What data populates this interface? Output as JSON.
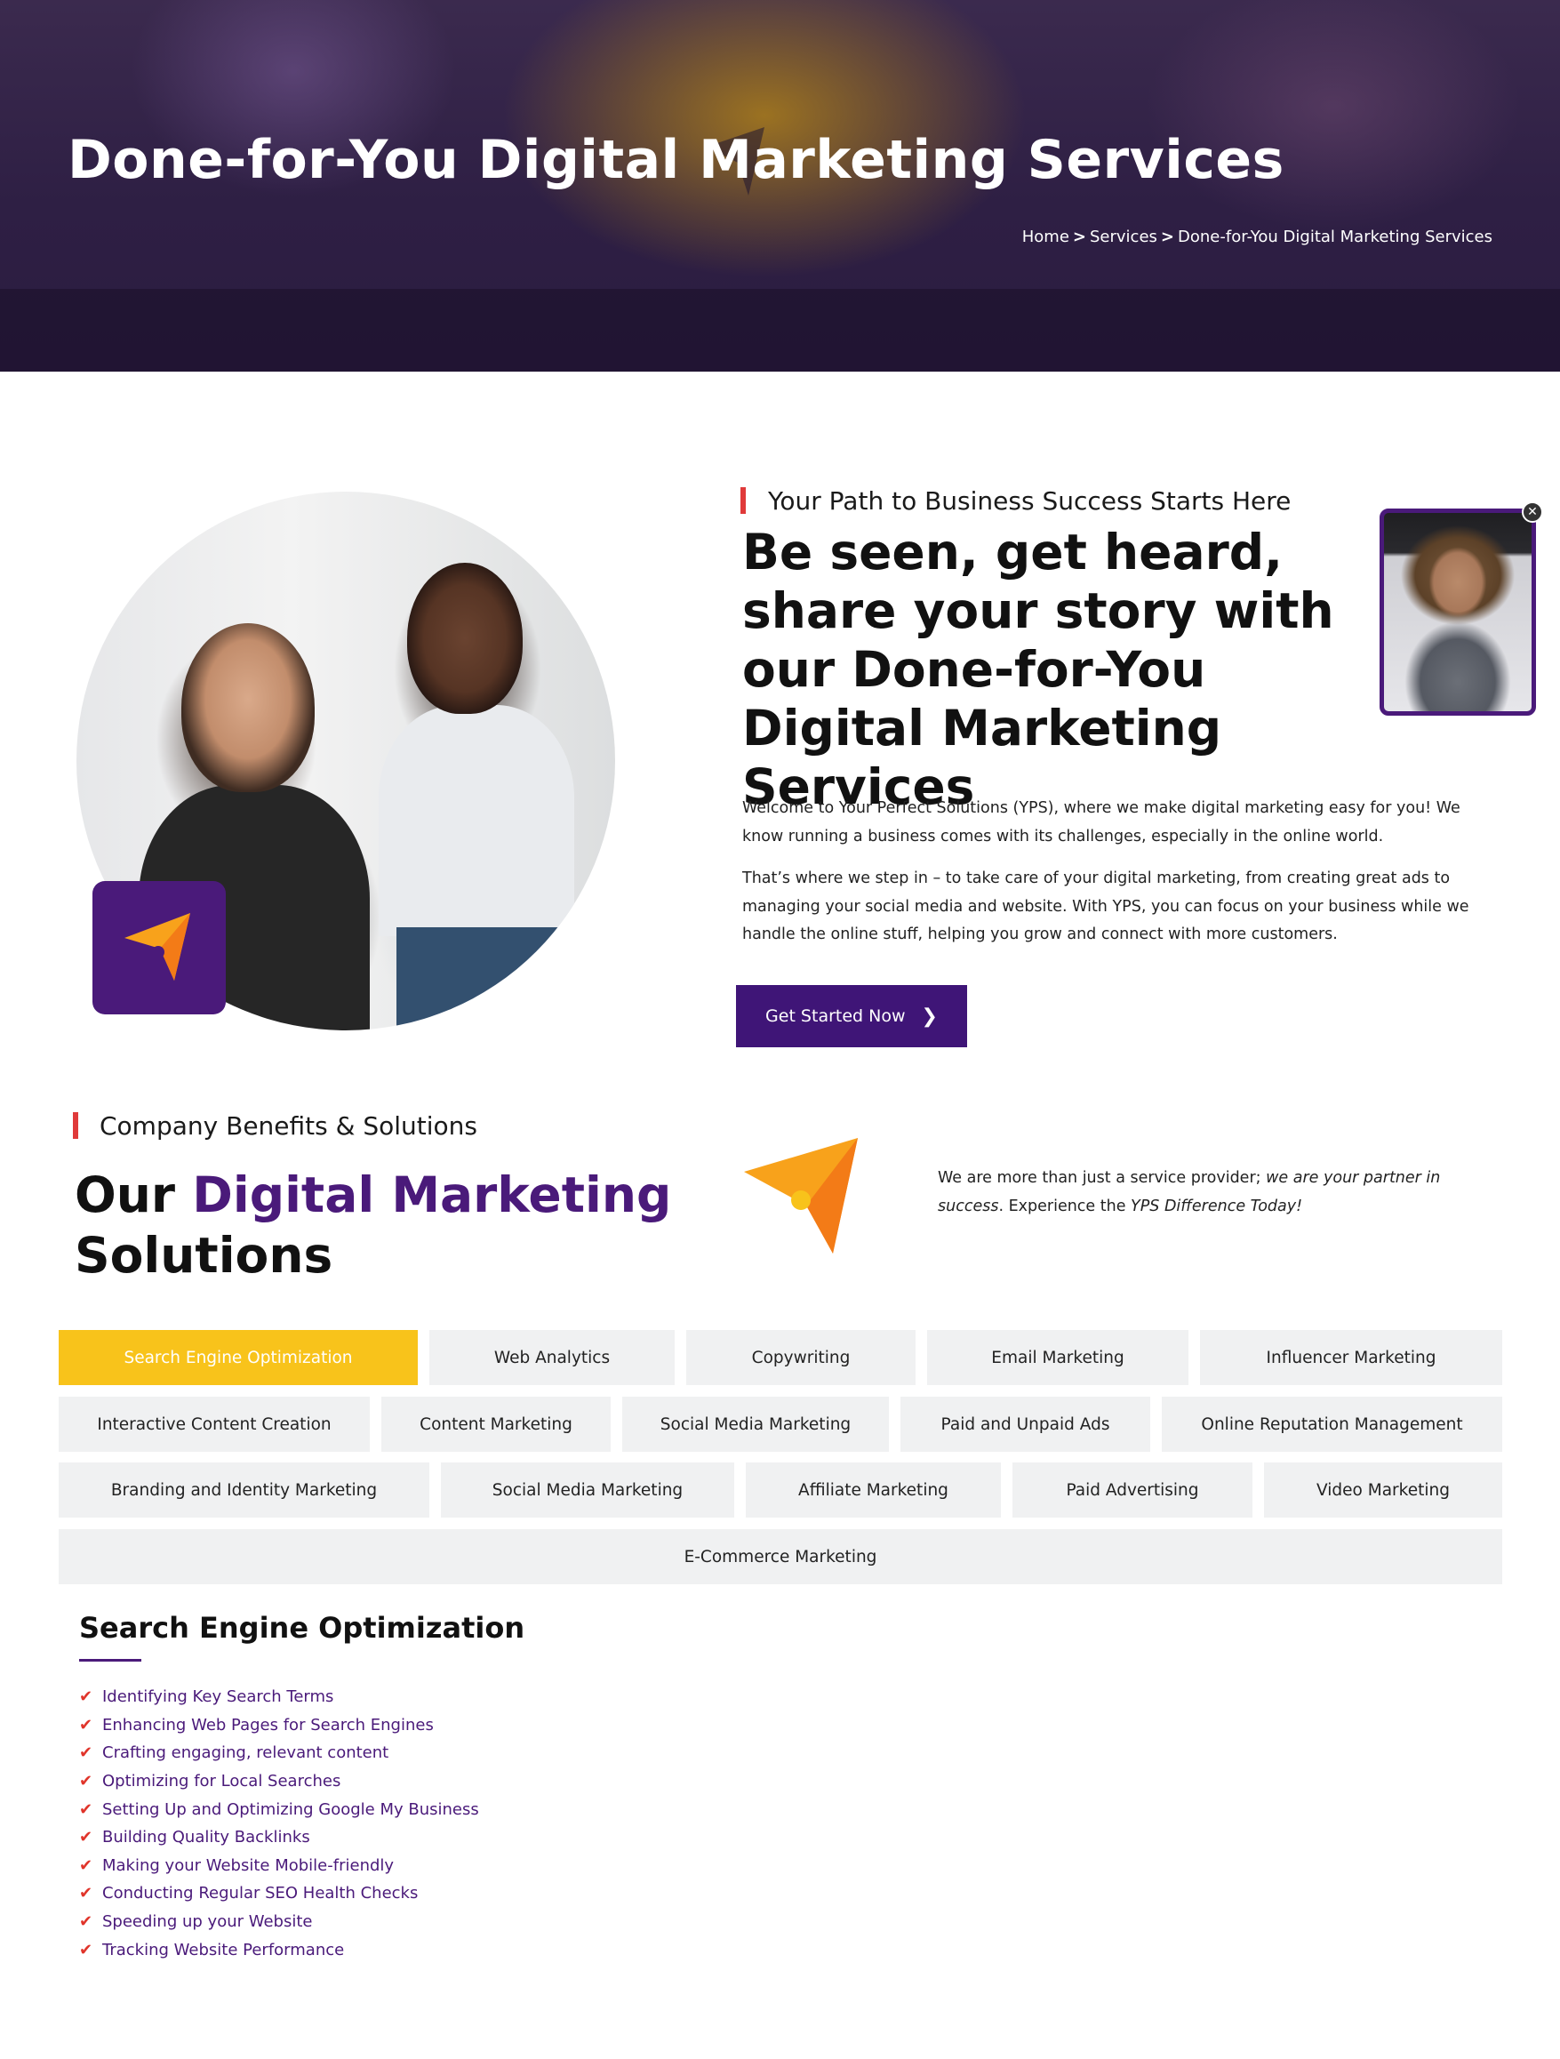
{
  "hero": {
    "title": "Done-for-You Digital Marketing Services",
    "breadcrumb": {
      "home": "Home",
      "separator": ">",
      "services": "Services",
      "current": "Done-for-You Digital Marketing Services"
    }
  },
  "intro": {
    "eyebrow": "Your Path to Business Success Starts Here",
    "headline": "Be seen, get heard, share your story with our Done-for-You Digital Marketing Services",
    "paragraph_1": "Welcome to Your Perfect Solutions (YPS), where we make digital marketing easy for you! We know running a business comes with its challenges, especially in the online world.",
    "paragraph_2": "That’s where we step in – to take care of your digital marketing, from creating great ads to managing your social media and website. With YPS, you can focus on your business while we handle the online stuff, helping you grow and connect with more customers.",
    "cta_label": "Get Started Now",
    "cta_icon": "chevron-right-icon",
    "video_close": "✕"
  },
  "benefits": {
    "eyebrow": "Company Benefits & Solutions",
    "title_prefix": "Our ",
    "title_highlight": "Digital Marketing",
    "title_suffix": "Solutions",
    "text_plain_1": "We are more than just a service provider; ",
    "text_italic_1": "we are your partner in success",
    "text_plain_2": ". Experience the ",
    "text_italic_2": "YPS Difference Today!"
  },
  "tabs": [
    "Search Engine Optimization",
    "Web Analytics",
    "Copywriting",
    "Email Marketing",
    "Influencer Marketing",
    "Interactive Content Creation",
    "Content Marketing",
    "Social Media Marketing",
    "Paid and Unpaid Ads",
    "Online Reputation Management",
    "Branding and Identity Marketing",
    "Social Media Marketing",
    "Affiliate Marketing",
    "Paid Advertising",
    "Video Marketing",
    "E-Commerce Marketing"
  ],
  "active_tab": "Search Engine Optimization",
  "seo": {
    "title": "Search Engine Optimization",
    "items": [
      "Identifying Key Search Terms",
      "Enhancing Web Pages for Search Engines",
      "Crafting engaging, relevant content",
      "Optimizing for Local Searches",
      "Setting Up and Optimizing Google My Business",
      "Building Quality Backlinks",
      "Making your Website Mobile-friendly",
      "Conducting Regular SEO Health Checks",
      "Speeding up your Website",
      "Tracking Website Performance"
    ],
    "bullet_icon": "double-check-icon"
  },
  "colors": {
    "brand_purple": "#4a1a7a",
    "accent_yellow": "#f8c31b",
    "accent_red": "#e03a3a",
    "logo_orange": "#f6a21a"
  }
}
